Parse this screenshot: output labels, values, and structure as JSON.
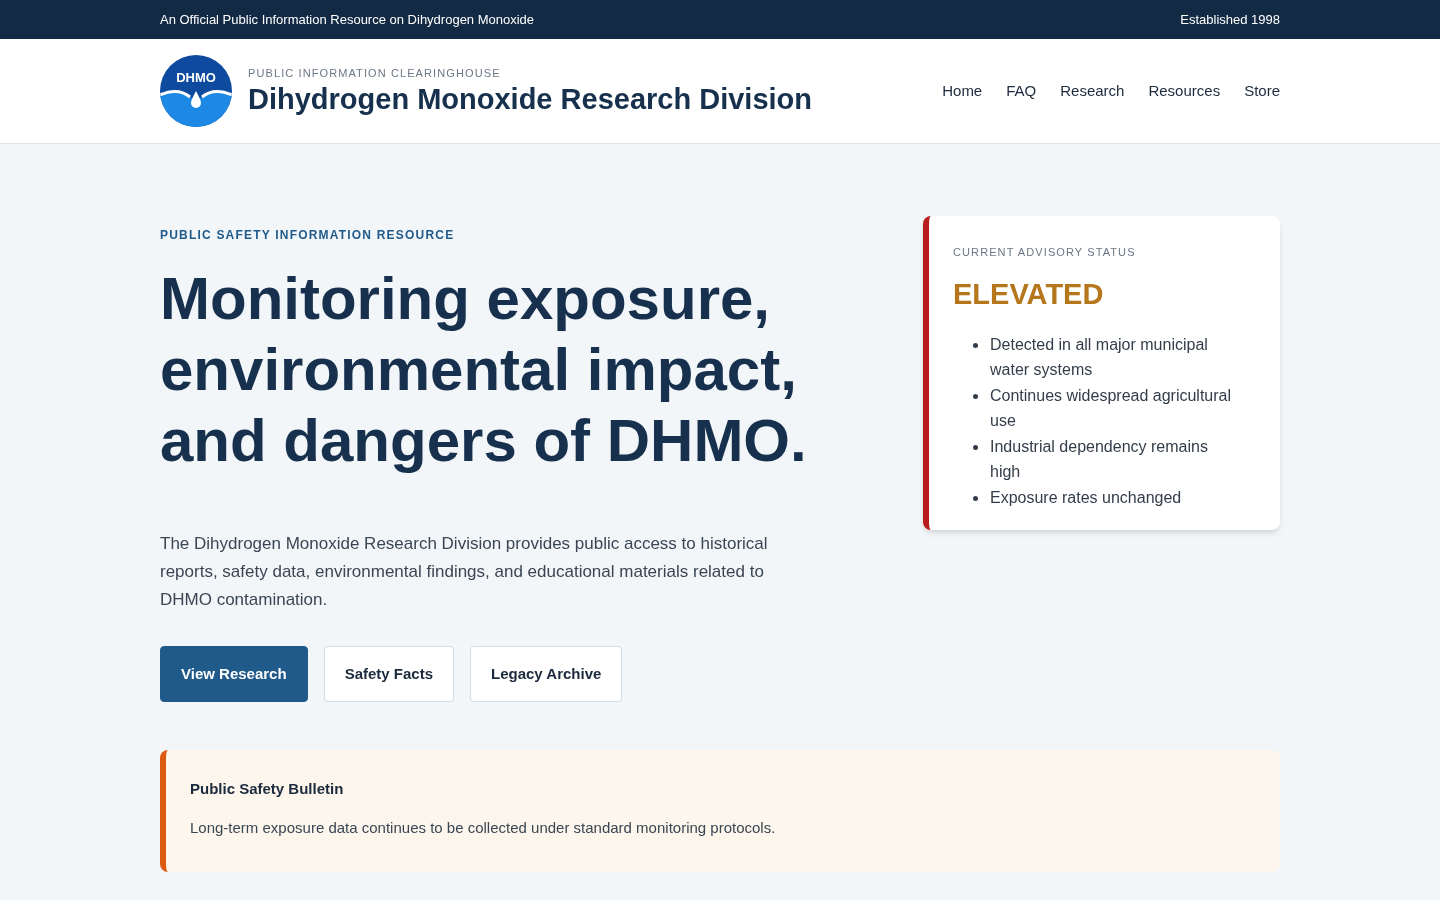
{
  "top_bar": {
    "left": "An Official Public Information Resource on Dihydrogen Monoxide",
    "right": "Established 1998"
  },
  "header": {
    "logo_text": "DHMO",
    "eyebrow": "PUBLIC INFORMATION CLEARINGHOUSE",
    "title": "Dihydrogen Monoxide Research Division",
    "nav": [
      "Home",
      "FAQ",
      "Research",
      "Resources",
      "Store"
    ]
  },
  "hero": {
    "eyebrow": "PUBLIC SAFETY INFORMATION RESOURCE",
    "heading": "Monitoring exposure, environmental impact, and dangers of DHMO.",
    "description": "The Dihydrogen Monoxide Research Division provides public access to historical reports, safety data, environmental findings, and educational materials related to DHMO contamination.",
    "buttons": [
      {
        "label": "View Research",
        "kind": "primary"
      },
      {
        "label": "Safety Facts",
        "kind": "secondary"
      },
      {
        "label": "Legacy Archive",
        "kind": "secondary"
      }
    ]
  },
  "advisory": {
    "label": "CURRENT ADVISORY STATUS",
    "status": "ELEVATED",
    "items": [
      "Detected in all major municipal water systems",
      "Continues widespread agricultural use",
      "Industrial dependency remains high",
      "Exposure rates unchanged"
    ]
  },
  "bulletin": {
    "title": "Public Safety Bulletin",
    "text": "Long-term exposure data continues to be collected under standard monitoring protocols."
  }
}
